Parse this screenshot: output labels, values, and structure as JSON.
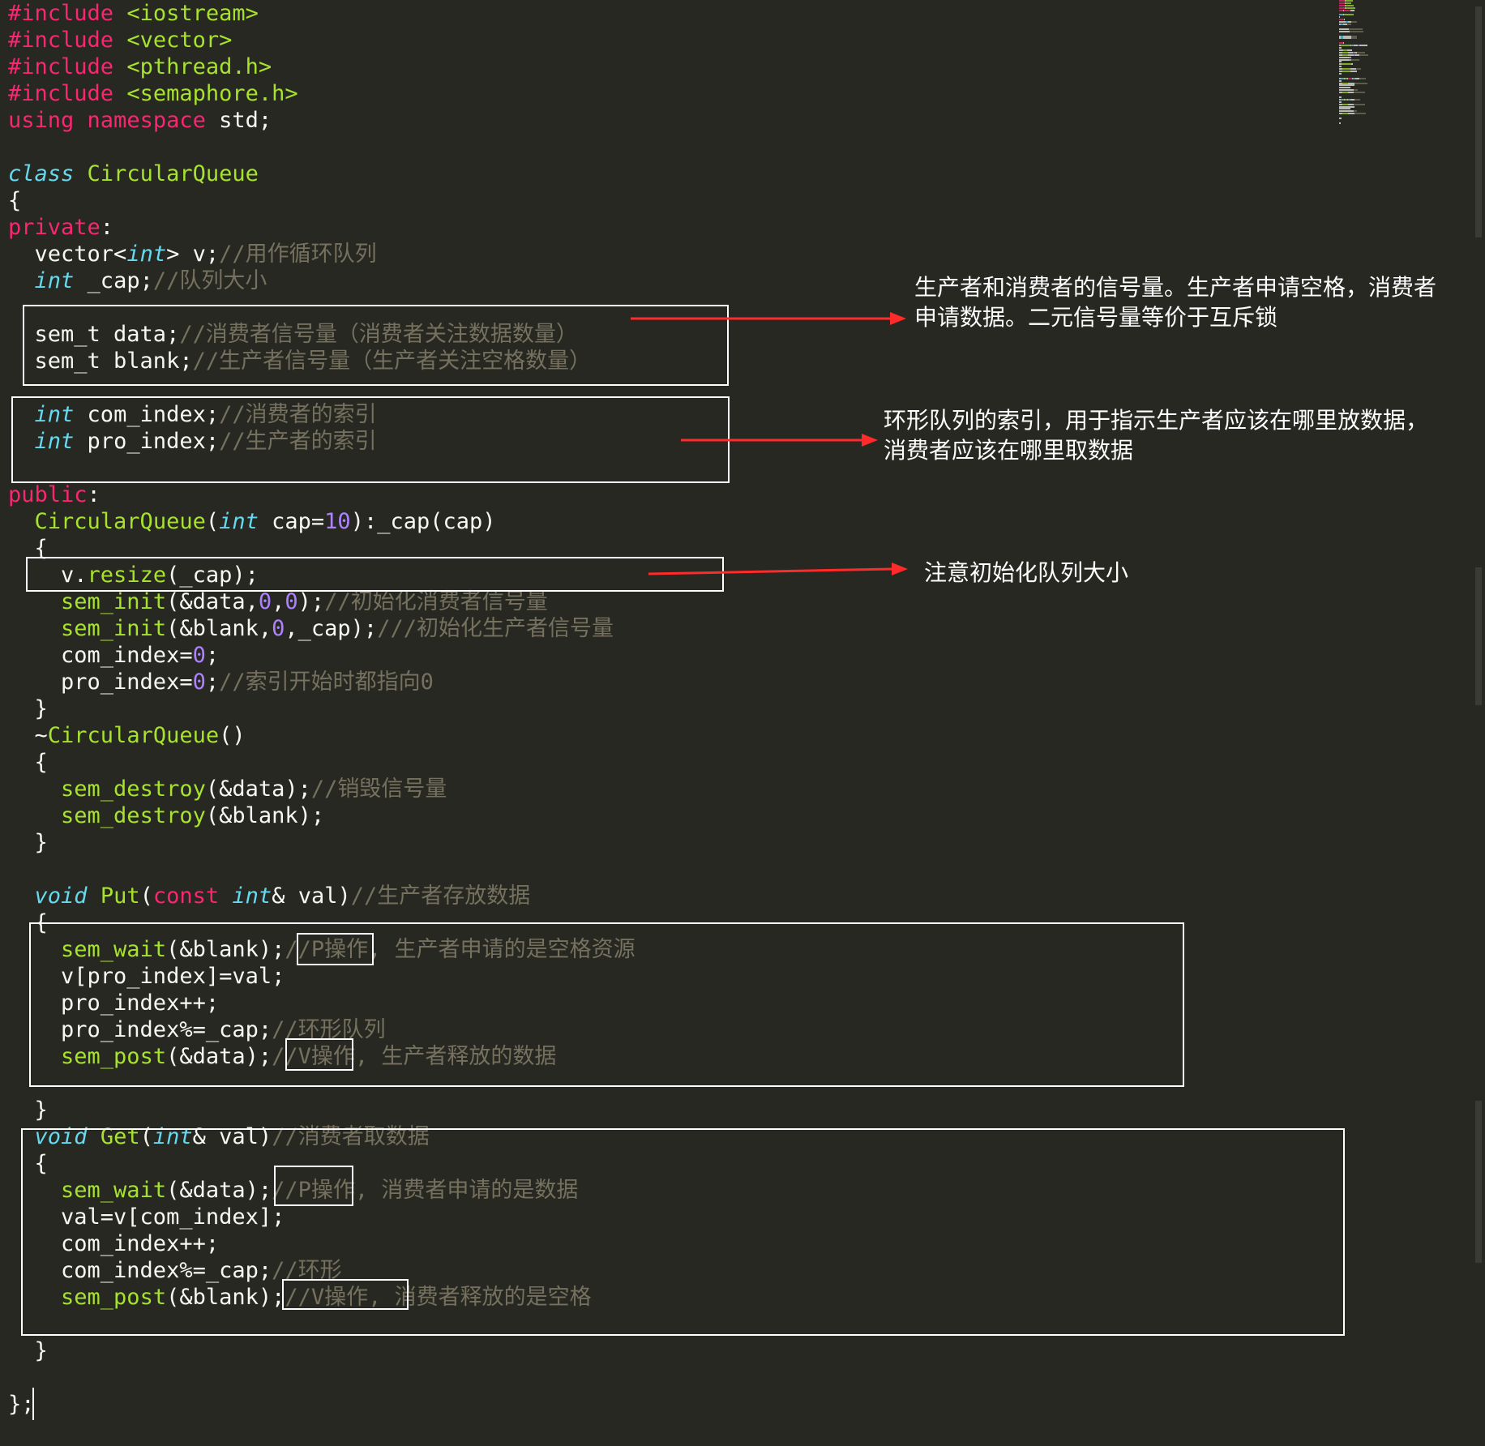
{
  "editor": {
    "theme_colors": {
      "background": "#272822",
      "plain": "#f8f8f2",
      "keyword": "#f92672",
      "type": "#66d9ef",
      "function": "#a6e22e",
      "number": "#ae81ff",
      "comment": "#75715e"
    },
    "code_lines": [
      [
        [
          "kw",
          "#include"
        ],
        [
          "pl",
          " "
        ],
        [
          "fn",
          "<iostream>"
        ]
      ],
      [
        [
          "kw",
          "#include"
        ],
        [
          "pl",
          " "
        ],
        [
          "fn",
          "<vector>"
        ]
      ],
      [
        [
          "kw",
          "#include"
        ],
        [
          "pl",
          " "
        ],
        [
          "fn",
          "<pthread.h>"
        ]
      ],
      [
        [
          "kw",
          "#include"
        ],
        [
          "pl",
          " "
        ],
        [
          "fn",
          "<semaphore.h>"
        ]
      ],
      [
        [
          "kw",
          "using"
        ],
        [
          "pl",
          " "
        ],
        [
          "kw",
          "namespace"
        ],
        [
          "pl",
          " std;"
        ]
      ],
      [],
      [
        [
          "ty",
          "class"
        ],
        [
          "pl",
          " "
        ],
        [
          "fn",
          "CircularQueue"
        ]
      ],
      [
        [
          "pl",
          "{"
        ]
      ],
      [
        [
          "kw",
          "private"
        ],
        [
          "pl",
          ":"
        ]
      ],
      [
        [
          "pl",
          "  vector<"
        ],
        [
          "ty",
          "int"
        ],
        [
          "pl",
          "> v;"
        ],
        [
          "cm",
          "//用作循环队列"
        ]
      ],
      [
        [
          "pl",
          "  "
        ],
        [
          "ty",
          "int"
        ],
        [
          "pl",
          " _cap;"
        ],
        [
          "cm",
          "//队列大小"
        ]
      ],
      [],
      [
        [
          "pl",
          "  sem_t data;"
        ],
        [
          "cm",
          "//消费者信号量（消费者关注数据数量）"
        ]
      ],
      [
        [
          "pl",
          "  sem_t blank;"
        ],
        [
          "cm",
          "//生产者信号量（生产者关注空格数量）"
        ]
      ],
      [],
      [
        [
          "pl",
          "  "
        ],
        [
          "ty",
          "int"
        ],
        [
          "pl",
          " com_index;"
        ],
        [
          "cm",
          "//消费者的索引"
        ]
      ],
      [
        [
          "pl",
          "  "
        ],
        [
          "ty",
          "int"
        ],
        [
          "pl",
          " pro_index;"
        ],
        [
          "cm",
          "//生产者的索引"
        ]
      ],
      [],
      [
        [
          "kw",
          "public"
        ],
        [
          "pl",
          ":"
        ]
      ],
      [
        [
          "pl",
          "  "
        ],
        [
          "fn",
          "CircularQueue"
        ],
        [
          "pl",
          "("
        ],
        [
          "ty",
          "int"
        ],
        [
          "pl",
          " cap="
        ],
        [
          "nm",
          "10"
        ],
        [
          "pl",
          "):_cap(cap)"
        ]
      ],
      [
        [
          "pl",
          "  {"
        ]
      ],
      [
        [
          "pl",
          "    v."
        ],
        [
          "fn",
          "resize"
        ],
        [
          "pl",
          "(_cap);"
        ]
      ],
      [
        [
          "pl",
          "    "
        ],
        [
          "fn",
          "sem_init"
        ],
        [
          "pl",
          "(&data,"
        ],
        [
          "nm",
          "0"
        ],
        [
          "pl",
          ","
        ],
        [
          "nm",
          "0"
        ],
        [
          "pl",
          ");"
        ],
        [
          "cm",
          "//初始化消费者信号量"
        ]
      ],
      [
        [
          "pl",
          "    "
        ],
        [
          "fn",
          "sem_init"
        ],
        [
          "pl",
          "(&blank,"
        ],
        [
          "nm",
          "0"
        ],
        [
          "pl",
          ",_cap);"
        ],
        [
          "cm",
          "///初始化生产者信号量"
        ]
      ],
      [
        [
          "pl",
          "    com_index="
        ],
        [
          "nm",
          "0"
        ],
        [
          "pl",
          ";"
        ]
      ],
      [
        [
          "pl",
          "    pro_index="
        ],
        [
          "nm",
          "0"
        ],
        [
          "pl",
          ";"
        ],
        [
          "cm",
          "//索引开始时都指向0"
        ]
      ],
      [
        [
          "pl",
          "  }"
        ]
      ],
      [
        [
          "pl",
          "  ~"
        ],
        [
          "fn",
          "CircularQueue"
        ],
        [
          "pl",
          "()"
        ]
      ],
      [
        [
          "pl",
          "  {"
        ]
      ],
      [
        [
          "pl",
          "    "
        ],
        [
          "fn",
          "sem_destroy"
        ],
        [
          "pl",
          "(&data);"
        ],
        [
          "cm",
          "//销毁信号量"
        ]
      ],
      [
        [
          "pl",
          "    "
        ],
        [
          "fn",
          "sem_destroy"
        ],
        [
          "pl",
          "(&blank);"
        ]
      ],
      [
        [
          "pl",
          "  }"
        ]
      ],
      [],
      [
        [
          "pl",
          "  "
        ],
        [
          "ty",
          "void"
        ],
        [
          "pl",
          " "
        ],
        [
          "fn",
          "Put"
        ],
        [
          "pl",
          "("
        ],
        [
          "kw",
          "const"
        ],
        [
          "pl",
          " "
        ],
        [
          "ty",
          "int"
        ],
        [
          "pl",
          "& val)"
        ],
        [
          "cm",
          "//生产者存放数据"
        ]
      ],
      [
        [
          "pl",
          "  {"
        ]
      ],
      [
        [
          "pl",
          "    "
        ],
        [
          "fn",
          "sem_wait"
        ],
        [
          "pl",
          "(&blank);"
        ],
        [
          "cm",
          "//P操作, 生产者申请的是空格资源"
        ]
      ],
      [
        [
          "pl",
          "    v[pro_index]=val;"
        ]
      ],
      [
        [
          "pl",
          "    pro_index++;"
        ]
      ],
      [
        [
          "pl",
          "    pro_index%=_cap;"
        ],
        [
          "cm",
          "//环形队列"
        ]
      ],
      [
        [
          "pl",
          "    "
        ],
        [
          "fn",
          "sem_post"
        ],
        [
          "pl",
          "(&data);"
        ],
        [
          "cm",
          "//V操作, 生产者释放的数据"
        ]
      ],
      [],
      [
        [
          "pl",
          "  }"
        ]
      ],
      [
        [
          "pl",
          "  "
        ],
        [
          "ty",
          "void"
        ],
        [
          "pl",
          " "
        ],
        [
          "fn",
          "Get"
        ],
        [
          "pl",
          "("
        ],
        [
          "ty",
          "int"
        ],
        [
          "pl",
          "& val)"
        ],
        [
          "cm",
          "//消费者取数据"
        ]
      ],
      [
        [
          "pl",
          "  {"
        ]
      ],
      [
        [
          "pl",
          "    "
        ],
        [
          "fn",
          "sem_wait"
        ],
        [
          "pl",
          "(&data);"
        ],
        [
          "cm",
          "//P操作, 消费者申请的是数据"
        ]
      ],
      [
        [
          "pl",
          "    val=v[com_index];"
        ]
      ],
      [
        [
          "pl",
          "    com_index++;"
        ]
      ],
      [
        [
          "pl",
          "    com_index%=_cap;"
        ],
        [
          "cm",
          "//环形"
        ]
      ],
      [
        [
          "pl",
          "    "
        ],
        [
          "fn",
          "sem_post"
        ],
        [
          "pl",
          "(&blank);"
        ],
        [
          "cm",
          "//V操作, 消费者释放的是空格"
        ]
      ],
      [],
      [
        [
          "pl",
          "  }"
        ]
      ],
      [],
      [
        [
          "pl",
          "};"
        ]
      ]
    ]
  },
  "annotations": {
    "semaphores": {
      "line1": "生产者和消费者的信号量。生产者申请空格，消费者",
      "line2": "申请数据。二元信号量等价于互斥锁"
    },
    "indexes": {
      "line1": "环形队列的索引，用于指示生产者应该在哪里放数据，",
      "line2": "消费者应该在哪里取数据"
    },
    "resize": {
      "line1": "注意初始化队列大小"
    },
    "arrow_color": "#ff2a2a",
    "box_color": "#ffffff"
  }
}
